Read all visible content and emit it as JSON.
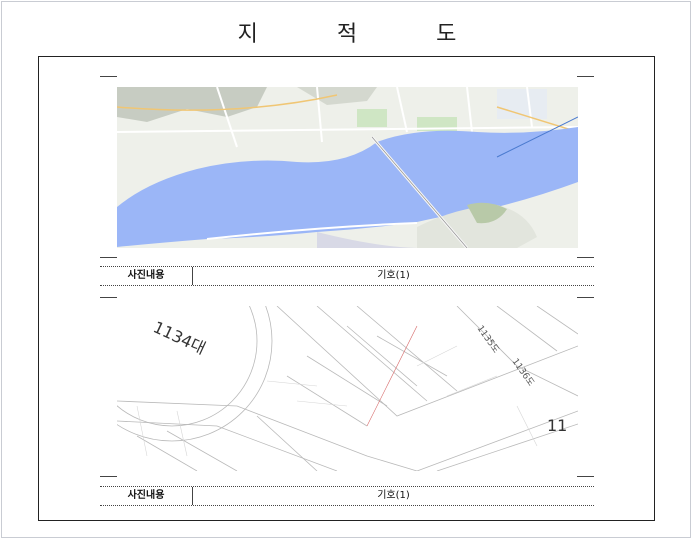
{
  "document": {
    "title": "지 적 도"
  },
  "panels": [
    {
      "kind": "aerial-map",
      "caption_label": "사진내용",
      "caption_value": "기호(1)"
    },
    {
      "kind": "cadastral-map",
      "caption_label": "사진내용",
      "caption_value": "기호(1)",
      "parcel_labels": [
        "1134대",
        "1135도",
        "1136도",
        "11"
      ]
    }
  ],
  "colors": {
    "water": "#9bb6f7",
    "land": "#eef0ea",
    "park": "#cfe6c4",
    "frame": "#222222"
  }
}
